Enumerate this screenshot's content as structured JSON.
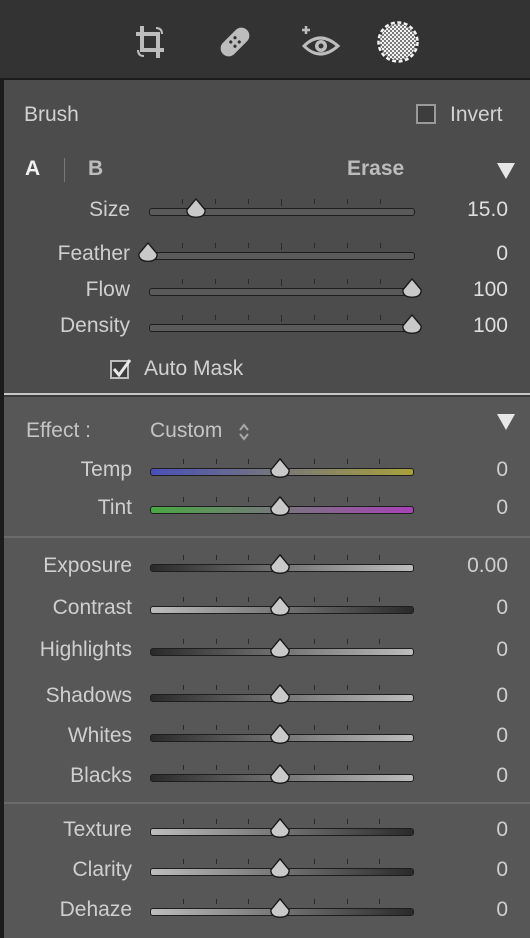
{
  "colors": {
    "panel_bg": "#4c4c4c",
    "effect_bg": "#575757",
    "toolbar_bg": "#333333",
    "text": "#d2d2d2"
  },
  "toolbar": {
    "tools": [
      {
        "name": "crop-icon"
      },
      {
        "name": "heal-icon"
      },
      {
        "name": "redeye-icon"
      },
      {
        "name": "mask-icon",
        "active": true
      }
    ]
  },
  "brush": {
    "title": "Brush",
    "invert_label": "Invert",
    "tab_a": "A",
    "tab_b": "B",
    "erase_label": "Erase",
    "auto_mask_label": "Auto Mask",
    "sliders": [
      {
        "id": "size",
        "label": "Size",
        "value": "15.0",
        "position": 0.18
      },
      {
        "id": "feather",
        "label": "Feather",
        "value": "0",
        "position": 0.0
      },
      {
        "id": "flow",
        "label": "Flow",
        "value": "100",
        "position": 1.0
      },
      {
        "id": "density",
        "label": "Density",
        "value": "100",
        "position": 1.0
      }
    ]
  },
  "effect": {
    "label": "Effect :",
    "preset": "Custom",
    "groups": [
      [
        {
          "id": "temp",
          "label": "Temp",
          "value": "0",
          "position": 0.5,
          "gradient": [
            "#4a4fb8",
            "#a8a23a"
          ]
        },
        {
          "id": "tint",
          "label": "Tint",
          "value": "0",
          "position": 0.5,
          "gradient": [
            "#49a843",
            "#a842b8"
          ]
        }
      ],
      [
        {
          "id": "exposure",
          "label": "Exposure",
          "value": "0.00",
          "position": 0.5,
          "gradient": [
            "#2a2a2a",
            "#bdbdbd"
          ]
        },
        {
          "id": "contrast",
          "label": "Contrast",
          "value": "0",
          "position": 0.5,
          "gradient": [
            "#bdbdbd",
            "#2a2a2a"
          ]
        },
        {
          "id": "highlights",
          "label": "Highlights",
          "value": "0",
          "position": 0.5,
          "gradient": [
            "#2a2a2a",
            "#bdbdbd"
          ]
        },
        {
          "id": "shadows",
          "label": "Shadows",
          "value": "0",
          "position": 0.5,
          "gradient": [
            "#2a2a2a",
            "#bdbdbd"
          ]
        },
        {
          "id": "whites",
          "label": "Whites",
          "value": "0",
          "position": 0.5,
          "gradient": [
            "#2a2a2a",
            "#bdbdbd"
          ]
        },
        {
          "id": "blacks",
          "label": "Blacks",
          "value": "0",
          "position": 0.5,
          "gradient": [
            "#2a2a2a",
            "#bdbdbd"
          ]
        }
      ],
      [
        {
          "id": "texture",
          "label": "Texture",
          "value": "0",
          "position": 0.5,
          "gradient": [
            "#bdbdbd",
            "#2a2a2a"
          ]
        },
        {
          "id": "clarity",
          "label": "Clarity",
          "value": "0",
          "position": 0.5,
          "gradient": [
            "#bdbdbd",
            "#2a2a2a"
          ]
        },
        {
          "id": "dehaze",
          "label": "Dehaze",
          "value": "0",
          "position": 0.5,
          "gradient": [
            "#bdbdbd",
            "#2a2a2a"
          ]
        }
      ]
    ]
  }
}
